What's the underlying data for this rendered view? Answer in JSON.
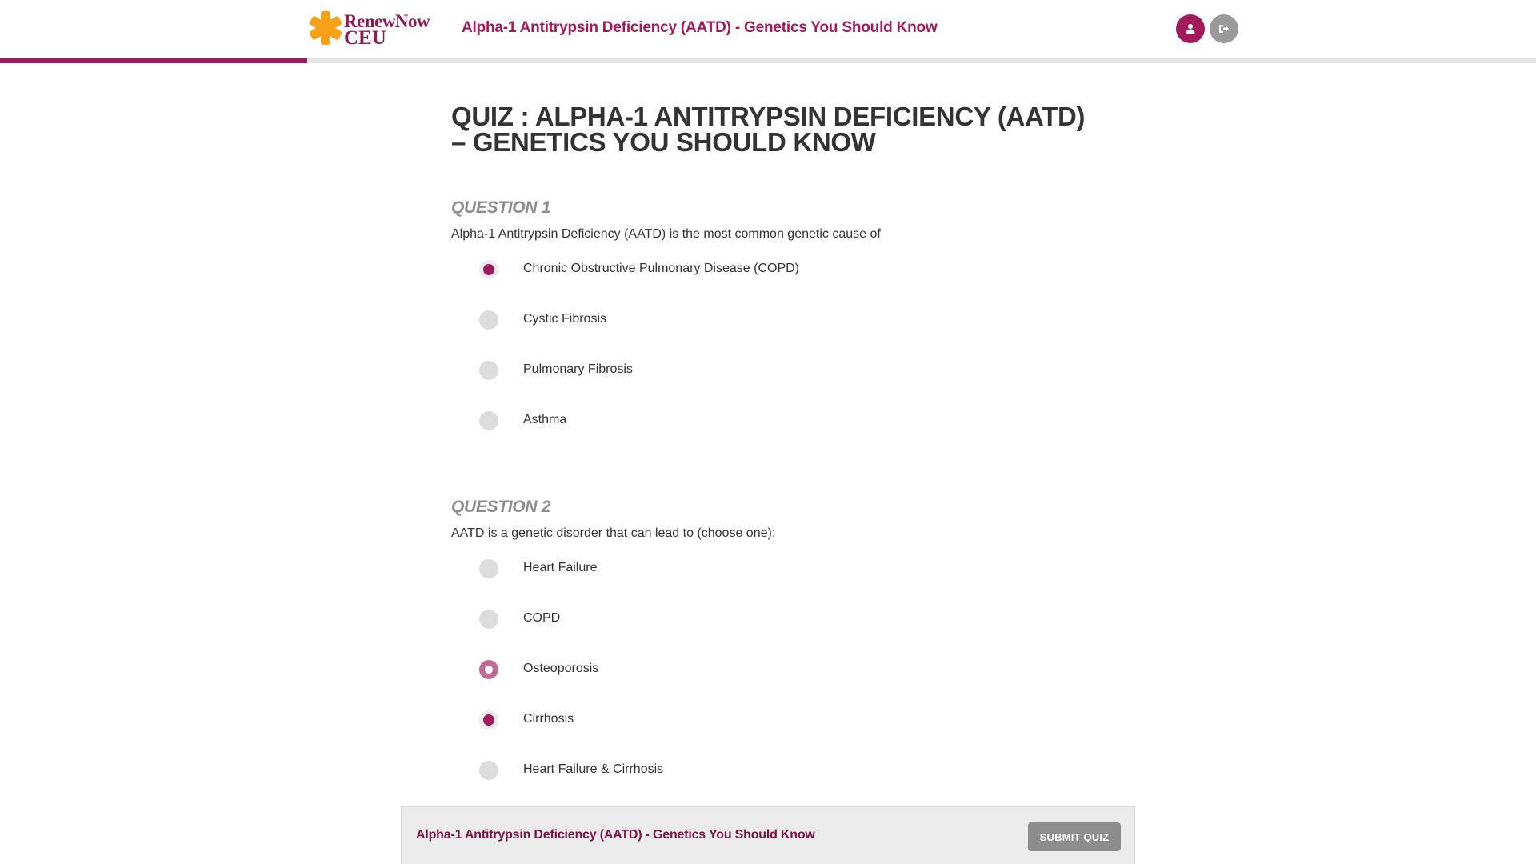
{
  "header": {
    "logo_line1": "RenewNow",
    "logo_line2": "CEU",
    "course_title": "Alpha-1 Antitrypsin Deficiency (AATD) - Genetics You Should Know",
    "profile_icon": "user-icon",
    "logout_icon": "sign-out-icon",
    "progress_fraction": 0.2
  },
  "quiz": {
    "title": "QUIZ : ALPHA-1 ANTITRYPSIN DEFICIENCY (AATD) – GENETICS YOU SHOULD KNOW",
    "questions": [
      {
        "heading": "QUESTION 1",
        "text": "Alpha-1 Antitrypsin Deficiency (AATD) is the most common genetic cause of",
        "options": [
          {
            "label": "Chronic Obstructive Pulmonary Disease (COPD)",
            "state": "checked"
          },
          {
            "label": "Cystic Fibrosis",
            "state": "unchecked"
          },
          {
            "label": "Pulmonary Fibrosis",
            "state": "unchecked"
          },
          {
            "label": "Asthma",
            "state": "unchecked"
          }
        ]
      },
      {
        "heading": "QUESTION 2",
        "text": "AATD is a genetic disorder that can lead to (choose one):",
        "options": [
          {
            "label": "Heart Failure",
            "state": "unchecked"
          },
          {
            "label": "COPD",
            "state": "unchecked"
          },
          {
            "label": "Osteoporosis",
            "state": "focused"
          },
          {
            "label": "Cirrhosis",
            "state": "checked"
          },
          {
            "label": "Heart Failure & Cirrhosis",
            "state": "unchecked"
          }
        ]
      }
    ]
  },
  "footer": {
    "title": "Alpha-1 Antitrypsin Deficiency (AATD) - Genetics You Should Know",
    "submit_label": "SUBMIT QUIZ"
  },
  "colors": {
    "brand": "#a3195b",
    "logo_star": "#f7a11a",
    "muted": "#8c8c8c"
  }
}
